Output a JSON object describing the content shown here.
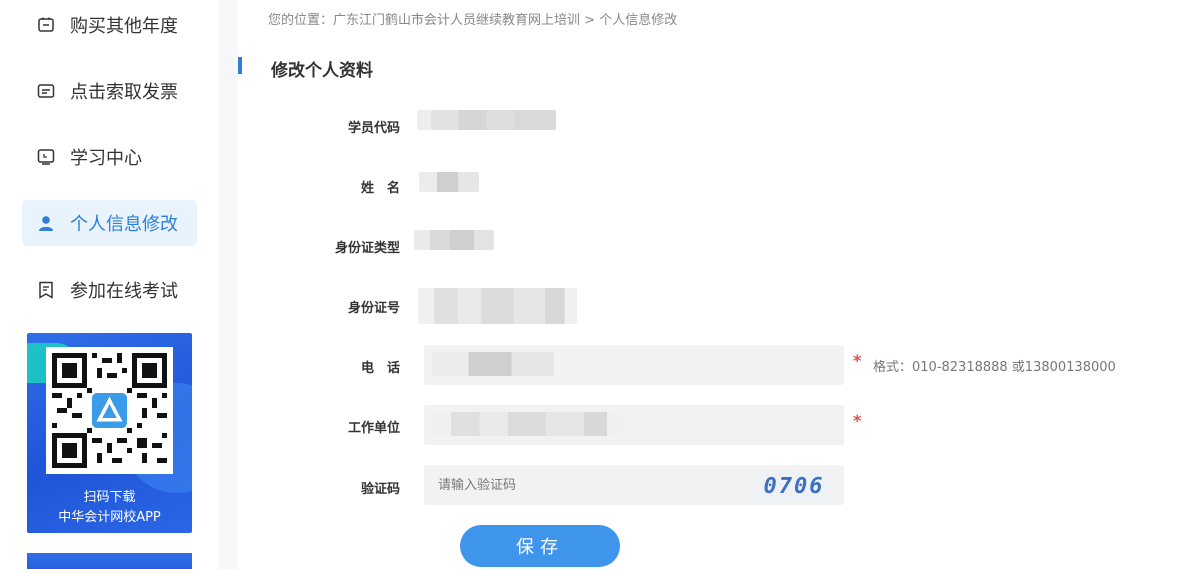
{
  "sidebar": {
    "items": [
      {
        "label": "购买其他年度",
        "icon": "calendar-icon",
        "active": false
      },
      {
        "label": "点击索取发票",
        "icon": "invoice-icon",
        "active": false
      },
      {
        "label": "学习中心",
        "icon": "monitor-icon",
        "active": false
      },
      {
        "label": "个人信息修改",
        "icon": "user-icon",
        "active": true
      },
      {
        "label": "参加在线考试",
        "icon": "exam-icon",
        "active": false
      }
    ],
    "promo": {
      "line1": "扫码下载",
      "line2": "中华会计网校APP"
    }
  },
  "breadcrumb": {
    "prefix": "您的位置：",
    "site": "广东江门鹤山市会计人员继续教育网上培训",
    "separator": ">",
    "current": "个人信息修改"
  },
  "form": {
    "title": "修改个人资料",
    "fields": {
      "student_id": {
        "label": "学员代码"
      },
      "name": {
        "label": "姓　名"
      },
      "id_type": {
        "label": "身份证类型"
      },
      "id_number": {
        "label": "身份证号"
      },
      "phone": {
        "label": "电　话",
        "hint": "格式：010-82318888 或13800138000"
      },
      "employer": {
        "label": "工作单位"
      },
      "captcha": {
        "label": "验证码",
        "placeholder": "请输入验证码",
        "code": "0706"
      }
    },
    "required_mark": "*",
    "save_label": "保存"
  },
  "colors": {
    "accent": "#2e7fd6",
    "button": "#3f95ec",
    "active_bg": "#e8f3fd",
    "required": "#e0504a"
  }
}
